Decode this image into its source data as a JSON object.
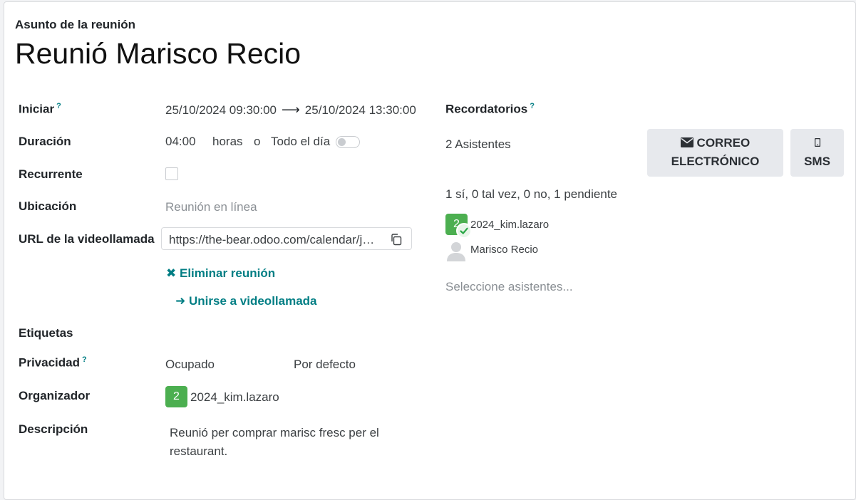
{
  "header": {
    "subject_label": "Asunto de la reunión",
    "title": "Reunió Marisco Recio"
  },
  "fields": {
    "start": {
      "label": "Iniciar",
      "help": "?",
      "from": "25/10/2024 09:30:00",
      "to": "25/10/2024 13:30:00"
    },
    "duration": {
      "label": "Duración",
      "value": "04:00",
      "unit": "horas",
      "or": "o",
      "all_day_label": "Todo el día",
      "all_day": false
    },
    "recurrent": {
      "label": "Recurrente",
      "checked": false
    },
    "location": {
      "label": "Ubicación",
      "placeholder": "Reunión en línea"
    },
    "video_url": {
      "label": "URL de la videollamada",
      "value": "https://the-bear.odoo.com/calendar/join_videocall/abc"
    },
    "delete_meeting": "Eliminar reunión",
    "join_videocall": "Unirse a videollamada",
    "tags": {
      "label": "Etiquetas"
    },
    "privacy": {
      "label": "Privacidad",
      "help": "?",
      "show_as": "Ocupado",
      "privacy_value": "Por defecto"
    },
    "organizer": {
      "label": "Organizador",
      "avatar_initial": "2",
      "name": "2024_kim.lazaro"
    },
    "description": {
      "label": "Descripción",
      "line1": "Reunió per comprar marisc fresc per el",
      "line2": "restaurant."
    }
  },
  "right": {
    "reminders": {
      "label": "Recordatorios",
      "help": "?"
    },
    "attendees_count": "2 Asistentes",
    "email_button": {
      "line1": "CORREO",
      "line2": "ELECTRÓNICO",
      "icon": "envelope-icon"
    },
    "sms_button": {
      "label": "SMS",
      "icon": "mobile-phone-icon"
    },
    "summary": "1 sí, 0 tal vez, 0 no, 1 pendiente",
    "attendees": [
      {
        "initial": "2",
        "name": "2024_kim.lazaro",
        "status": "accepted"
      },
      {
        "name": "Marisco Recio",
        "status": "pending"
      }
    ],
    "select_placeholder": "Seleccione asistentes..."
  },
  "colors": {
    "accent": "#017e84",
    "avatar": "#4caf50",
    "button_bg": "#e7e9ed"
  }
}
